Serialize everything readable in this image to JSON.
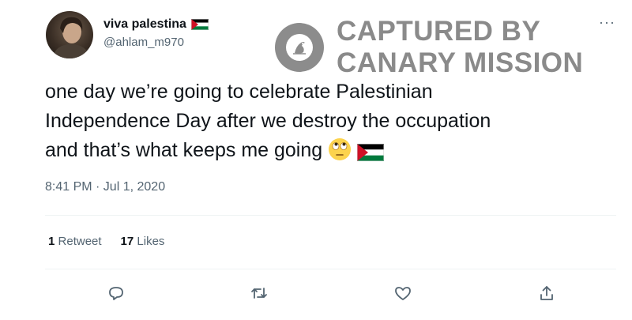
{
  "user": {
    "display_name": "viva palestina",
    "handle": "@ahlam_m970",
    "name_flag_icon": "palestine-flag-icon"
  },
  "watermark": {
    "line1": "CAPTURED BY",
    "line2": "CANARY MISSION",
    "logo_icon": "canary-bird-icon"
  },
  "menu": {
    "icon": "more-options-icon",
    "glyph": "···"
  },
  "tweet": {
    "text_line1": "one day we’re going to celebrate Palestinian",
    "text_line2": "Independence Day after we destroy the occupation",
    "text_line3": "and that’s what keeps me going",
    "emojis": [
      "face-with-rolling-eyes-icon",
      "palestine-flag-icon"
    ],
    "timestamp": "8:41 PM · Jul 1, 2020"
  },
  "stats": {
    "retweets_count": "1",
    "retweets_label": "Retweet",
    "likes_count": "17",
    "likes_label": "Likes"
  },
  "actions": [
    "reply-icon",
    "retweet-icon",
    "like-icon",
    "share-icon"
  ],
  "colors": {
    "text": "#0f1419",
    "secondary": "#536471",
    "divider": "#eff3f4",
    "watermark": "#8a8a8a",
    "flag_red": "#ce1126",
    "flag_green": "#007a3d"
  }
}
